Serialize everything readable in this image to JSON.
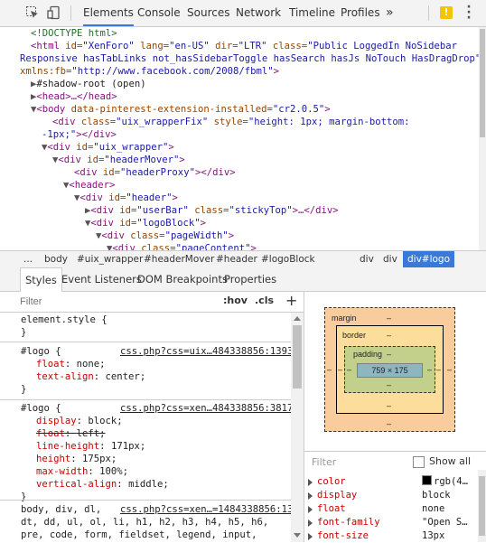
{
  "toolbar": {
    "tabs": [
      "Elements",
      "Console",
      "Sources",
      "Network",
      "Timeline",
      "Profiles"
    ],
    "overflow": "»",
    "warning_count": "!"
  },
  "dom": {
    "doctype": "<!DOCTYPE html>",
    "html_open_1": [
      "<html",
      " id=",
      "\"XenForo\"",
      " lang=",
      "\"en-US\"",
      " dir=",
      "\"LTR\"",
      " class=",
      "\"Public LoggedIn NoSidebar"
    ],
    "html_open_2": "Responsive hasTabLinks not_hasSidebarToggle hasSearch hasJs NoTouch HasDragDrop\"",
    "html_open_3": [
      "xmlns:fb=",
      "\"http://www.facebook.com/2008/fbml\"",
      ">"
    ],
    "shadow_root": "#shadow-root (open)",
    "head": "<head>…</head>",
    "body_open": [
      "<body",
      " data-pinterest-extension-installed=",
      "\"cr2.0.5\"",
      ">"
    ],
    "wrapperfix_1": [
      "<div",
      " class=",
      "\"uix_wrapperFix\"",
      " style=",
      "\"height: 1px; margin-bottom:"
    ],
    "wrapperfix_2": [
      "-1px;\"",
      "></div>"
    ],
    "uix_wrapper": [
      "<div",
      " id=",
      "\"uix_wrapper\"",
      ">"
    ],
    "header_mover": [
      "<div",
      " id=",
      "\"headerMover\"",
      ">"
    ],
    "header_proxy": [
      "<div",
      " id=",
      "\"headerProxy\"",
      "></div>"
    ],
    "header_tag": "<header>",
    "header_div": [
      "<div",
      " id=",
      "\"header\"",
      ">"
    ],
    "userbar": [
      "<div",
      " id=",
      "\"userBar\"",
      " class=",
      "\"stickyTop\"",
      ">…</div>"
    ],
    "logoblock": [
      "<div",
      " id=",
      "\"logoBlock\"",
      ">"
    ],
    "pagewidth": [
      "<div",
      " class=",
      "\"pageWidth\"",
      ">"
    ],
    "pagecontent": [
      "<div",
      " class=",
      "\"pageContent\"",
      ">"
    ]
  },
  "breadcrumbs": [
    "...",
    "body",
    "#uix_wrapper",
    "#headerMover",
    "#header",
    "#logoBlock",
    "div",
    "div",
    "div#logo"
  ],
  "styles_tabs": [
    "Styles",
    "Event Listeners",
    "DOM Breakpoints",
    "Properties"
  ],
  "styles_filter": {
    "placeholder": "Filter",
    "hov": ":hov",
    "cls": ".cls",
    "add": "+"
  },
  "rules": {
    "element_style": "element.style {",
    "close": "}",
    "r1_selector": "#logo {",
    "r1_source": "css.php?css=uix…484338856:1393",
    "r1_props": [
      [
        "float",
        "none;"
      ],
      [
        "text-align",
        "center;"
      ]
    ],
    "r2_selector": "#logo {",
    "r2_source": "css.php?css=xen…484338856:3817",
    "r2_props": [
      [
        "display",
        "block;"
      ],
      [
        "float",
        "left;"
      ],
      [
        "line-height",
        "171px;"
      ],
      [
        "height",
        "175px;"
      ],
      [
        "max-width",
        "100%;"
      ],
      [
        "vertical-align",
        "middle;"
      ]
    ],
    "r3_sel_1": "body, div, dl,",
    "r3_source": "css.php?css=xen…=1484338856:13",
    "r3_sel_2": "dt, dd, ul, ol, li, h1, h2, h3, h4, h5, h6,",
    "r3_sel_3": "pre, code, form, fieldset, legend, input,"
  },
  "box_model": {
    "margin_label": "margin",
    "border_label": "border",
    "padding_label": "padding",
    "dash": "–",
    "content_size": "759 × 175"
  },
  "computed": {
    "filter_placeholder": "Filter",
    "show_all": "Show all",
    "rows": [
      {
        "name": "color",
        "value": "rgb(4…",
        "swatch": "#000000"
      },
      {
        "name": "display",
        "value": "block"
      },
      {
        "name": "float",
        "value": "none"
      },
      {
        "name": "font-family",
        "value": "\"Open S…"
      },
      {
        "name": "font-size",
        "value": "13px"
      }
    ]
  }
}
